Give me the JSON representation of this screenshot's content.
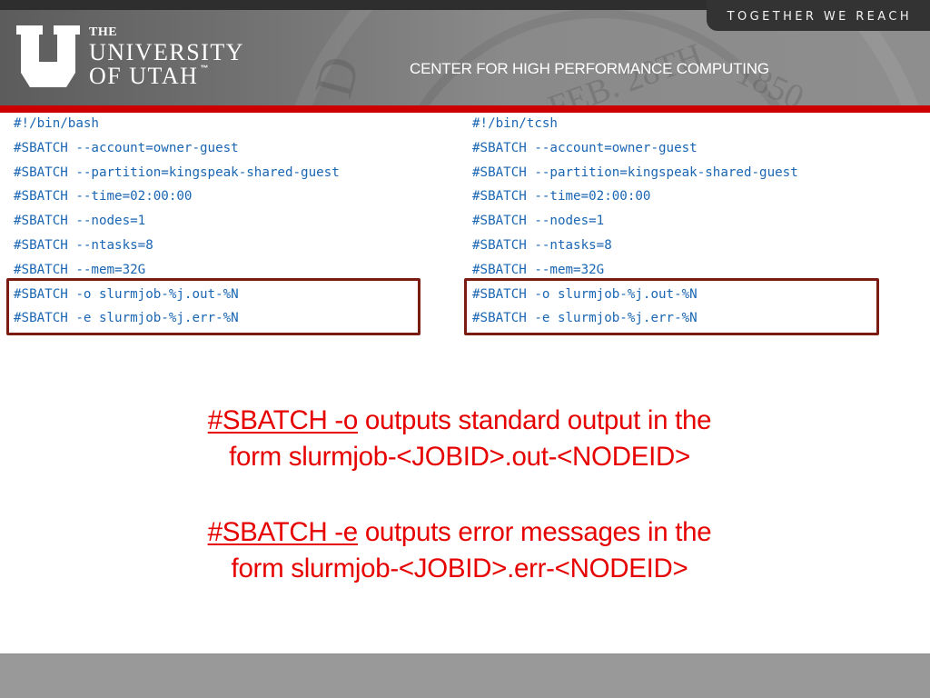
{
  "header": {
    "tagline": "TOGETHER WE REACH",
    "logo": {
      "icon": "university-u-logo-icon",
      "line1": "THE",
      "line2": "UNIVERSITY",
      "line3": "OF UTAH",
      "trademark": "™"
    },
    "center_title": "CENTER FOR HIGH PERFORMANCE COMPUTING",
    "seal_text": {
      "date": "FEB. 28TH",
      "year": "1850",
      "letter": "D"
    },
    "accent_color": "#cc0000"
  },
  "scripts": [
    {
      "shell": "bash",
      "lines": [
        "#!/bin/bash",
        "#SBATCH --account=owner-guest",
        "#SBATCH --partition=kingspeak-shared-guest",
        "#SBATCH --time=02:00:00",
        "#SBATCH --nodes=1",
        "#SBATCH --ntasks=8",
        "#SBATCH --mem=32G",
        "#SBATCH -o slurmjob-%j.out-%N",
        "#SBATCH -e slurmjob-%j.err-%N"
      ],
      "highlighted_lines": [
        7,
        8
      ]
    },
    {
      "shell": "tcsh",
      "lines": [
        "#!/bin/tcsh",
        "#SBATCH --account=owner-guest",
        "#SBATCH --partition=kingspeak-shared-guest",
        "#SBATCH --time=02:00:00",
        "#SBATCH --nodes=1",
        "#SBATCH --ntasks=8",
        "#SBATCH --mem=32G",
        "#SBATCH -o slurmjob-%j.out-%N",
        "#SBATCH -e slurmjob-%j.err-%N"
      ],
      "highlighted_lines": [
        7,
        8
      ]
    }
  ],
  "explanations": {
    "output": {
      "keyword": "#SBATCH -o",
      "line1_rest": " outputs standard output in the",
      "line2": "form slurmjob-<JOBID>.out-<NODEID>"
    },
    "error": {
      "keyword": "#SBATCH -e",
      "line1_rest": " outputs error messages in the",
      "line2": "form slurmjob-<JOBID>.err-<NODEID>"
    }
  },
  "colors": {
    "code_text": "#1a66b3",
    "highlight_border": "#7b1c12",
    "explanation_text": "#e60000",
    "footer": "#999999"
  }
}
